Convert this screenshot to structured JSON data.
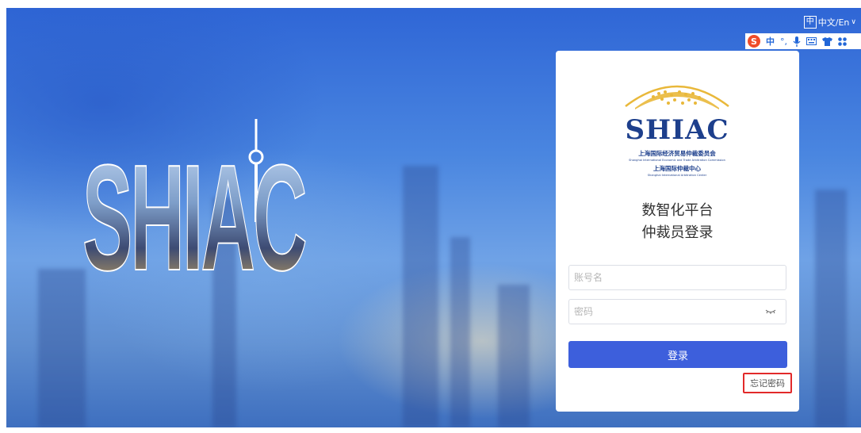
{
  "header": {
    "lang_icon": "中",
    "lang_label": "中文/En",
    "lang_caret": "∨"
  },
  "ime_toolbar": {
    "logo": "S",
    "mode": "中",
    "punct": "°,",
    "icons": [
      "mic-icon",
      "keyboard-icon",
      "skin-icon",
      "grid-icon"
    ]
  },
  "hero": {
    "text": "SHIAC"
  },
  "login": {
    "logo_name": "SHIAC",
    "logo_cn": "上海国际经济贸易仲裁委员会",
    "logo_en": "Shanghai International Economic and Trade Arbitration Commission",
    "logo_cn2": "上海国际仲裁中心",
    "logo_en2": "Shanghai International Arbitration Center",
    "title_line1": "数智化平台",
    "title_line2": "仲裁员登录",
    "username_placeholder": "账号名",
    "password_placeholder": "密码",
    "login_button": "登录",
    "forgot_password": "忘记密码"
  },
  "colors": {
    "primary": "#3d5fdc",
    "brand_navy": "#1d3f8c",
    "brand_gold": "#e9b83a",
    "highlight_red": "#e22a2a"
  }
}
